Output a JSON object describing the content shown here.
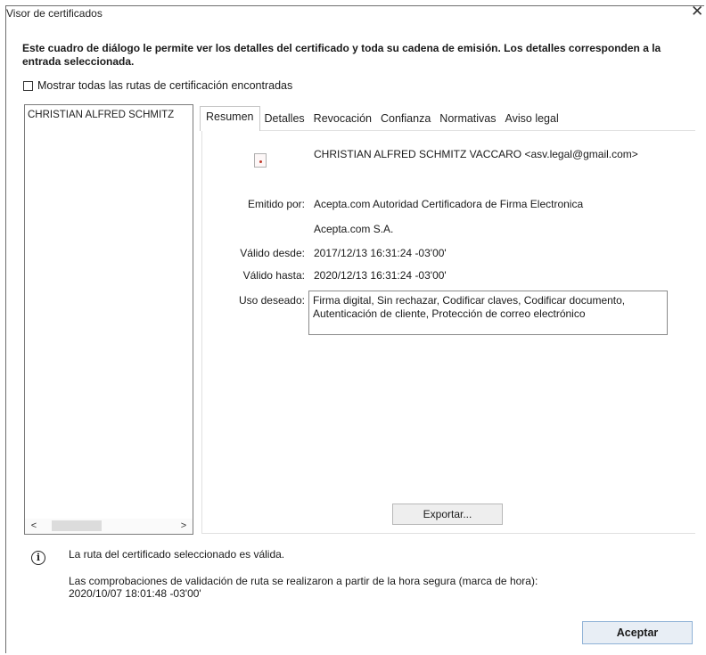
{
  "window": {
    "title": "Visor de certificados",
    "close_glyph": "✕"
  },
  "intro_text": "Este cuadro de diálogo le permite ver los detalles del certificado y toda su cadena de emisión. Los detalles corresponden a la entrada seleccionada.",
  "show_all_paths": {
    "label": "Mostrar todas las rutas de certificación encontradas",
    "checked": false
  },
  "tree": {
    "items": [
      "CHRISTIAN ALFRED SCHMITZ"
    ],
    "scroll_left": "<",
    "scroll_right": ">"
  },
  "tabs": [
    "Resumen",
    "Detalles",
    "Revocación",
    "Confianza",
    "Normativas",
    "Aviso legal"
  ],
  "active_tab": "Resumen",
  "summary": {
    "subject": "CHRISTIAN ALFRED SCHMITZ VACCARO <asv.legal@gmail.com>",
    "issued_by_label": "Emitido por:",
    "issued_by_1": "Acepta.com Autoridad Certificadora de Firma Electronica",
    "issued_by_2": "Acepta.com S.A.",
    "valid_from_label": "Válido desde:",
    "valid_from": "2017/12/13 16:31:24 -03'00'",
    "valid_to_label": "Válido hasta:",
    "valid_to": "2020/12/13 16:31:24 -03'00'",
    "usage_label": "Uso deseado:",
    "usage_line1": "Firma digital, Sin rechazar, Codificar claves, Codificar documento,",
    "usage_line2": "Autenticación de cliente, Protección de correo electrónico"
  },
  "export_button": "Exportar...",
  "status": {
    "icon": "i",
    "path_valid": "La ruta del certificado seleccionado es válida.",
    "validation_note": "Las comprobaciones de validación de ruta se realizaron a partir de la hora segura (marca de hora):",
    "timestamp": "2020/10/07 18:01:48 -03'00'"
  },
  "ok_button": "Aceptar",
  "icons": {
    "close": "close-icon",
    "certificate": "certificate-document-icon",
    "info": "info-icon"
  }
}
